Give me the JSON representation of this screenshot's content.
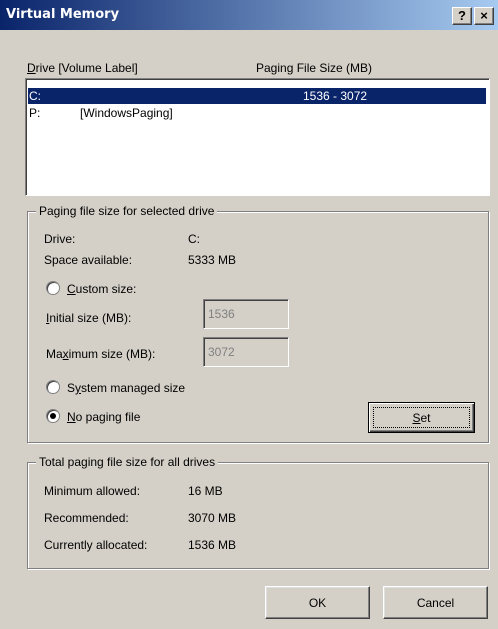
{
  "window": {
    "title": "Virtual Memory",
    "help_button": "?",
    "close_button": "×"
  },
  "drive_list": {
    "header_drive_prefix": "D",
    "header_drive_rest": "rive  [Volume Label]",
    "header_paging": "Paging File Size (MB)",
    "rows": [
      {
        "drive": "C:",
        "label": "",
        "size": "1536 - 3072",
        "selected": true
      },
      {
        "drive": "P:",
        "label": "[WindowsPaging]",
        "size": "",
        "selected": false
      }
    ]
  },
  "selected_drive": {
    "group_title": "Paging file size for selected drive",
    "drive_label": "Drive:",
    "drive_value": "C:",
    "space_label": "Space available:",
    "space_value": "5333 MB",
    "custom_prefix": "",
    "custom_key": "C",
    "custom_rest": "ustom size:",
    "initial_key": "I",
    "initial_rest": "nitial size (MB):",
    "initial_value": "1536",
    "maximum_prefix": "Ma",
    "maximum_key": "x",
    "maximum_rest": "imum size (MB):",
    "maximum_value": "3072",
    "system_prefix": "S",
    "system_key": "y",
    "system_rest": "stem managed size",
    "nopaging_key": "N",
    "nopaging_rest": "o paging file",
    "selected_option": "no_paging",
    "set_key": "S",
    "set_rest": "et"
  },
  "totals": {
    "group_title": "Total paging file size for all drives",
    "min_label": "Minimum allowed:",
    "min_value": "16 MB",
    "rec_label": "Recommended:",
    "rec_value": "3070 MB",
    "cur_label": "Currently allocated:",
    "cur_value": "1536 MB"
  },
  "buttons": {
    "ok": "OK",
    "cancel": "Cancel"
  }
}
